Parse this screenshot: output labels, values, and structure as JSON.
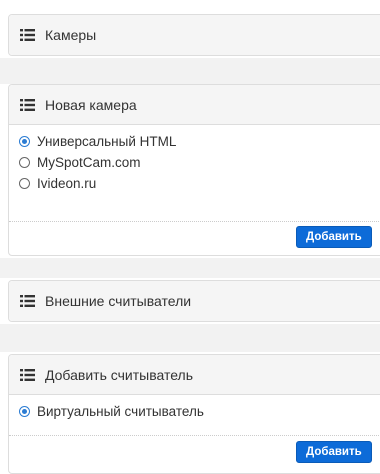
{
  "sections": {
    "cameras": {
      "title": "Камеры",
      "icon": "list-icon"
    },
    "new_camera": {
      "title": "Новая камера",
      "icon": "list-icon",
      "options": [
        {
          "label": "Универсальный HTML",
          "checked": true
        },
        {
          "label": "MySpotCam.com",
          "checked": false
        },
        {
          "label": "Ivideon.ru",
          "checked": false
        }
      ],
      "button_label": "Добавить"
    },
    "external_readers": {
      "title": "Внешние считыватели",
      "icon": "list-icon"
    },
    "add_reader": {
      "title": "Добавить считыватель",
      "icon": "list-icon",
      "options": [
        {
          "label": "Виртуальный считыватель",
          "checked": true
        }
      ],
      "button_label": "Добавить"
    }
  },
  "colors": {
    "accent": "#0d6bd8",
    "radio_checked": "#2b7cd3",
    "panel_header_bg": "#f5f5f5",
    "border": "#dddddd"
  }
}
